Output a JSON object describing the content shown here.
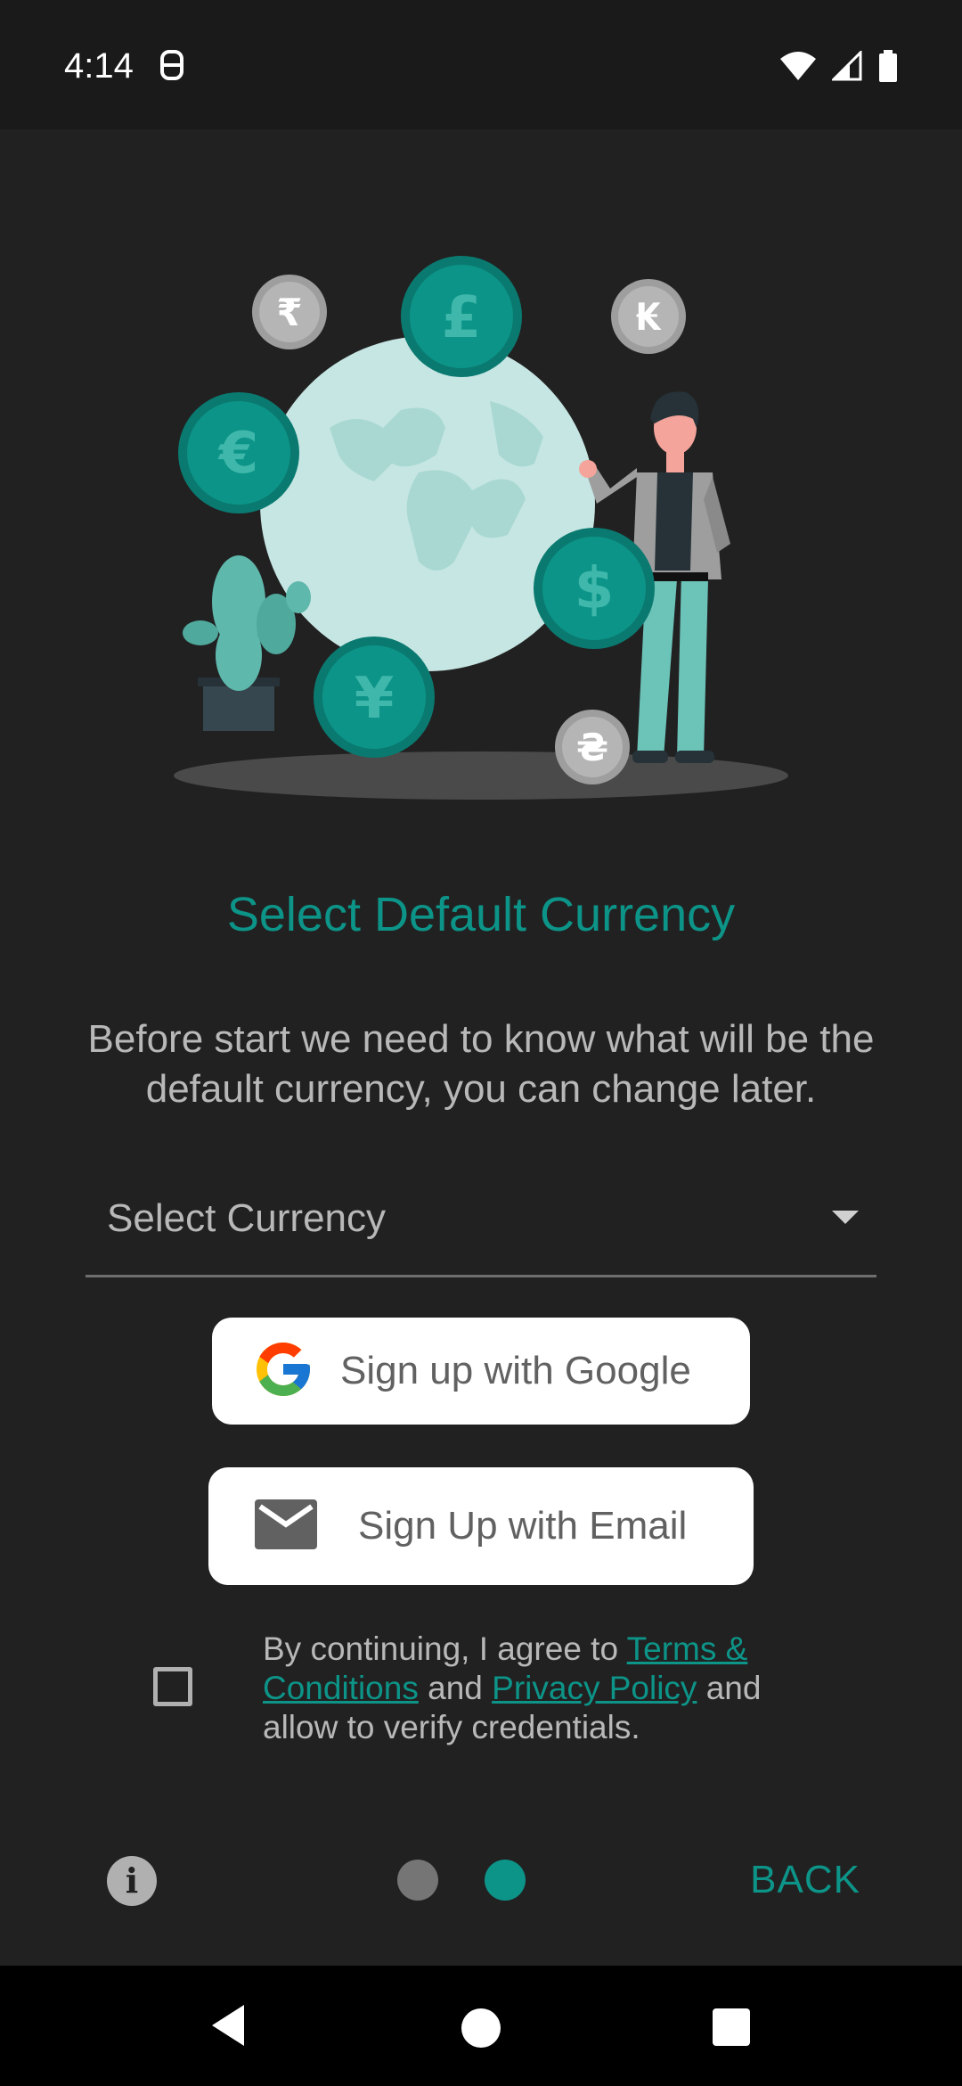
{
  "status_bar": {
    "time": "4:14"
  },
  "illustration": {
    "currency_symbols": [
      "₹",
      "£",
      "₭",
      "€",
      "$",
      "¥",
      "₴"
    ]
  },
  "onboarding": {
    "title": "Select Default Currency",
    "subtitle": "Before start we need to know what will be the default currency, you can change later."
  },
  "currency_select": {
    "placeholder": "Select Currency"
  },
  "buttons": {
    "google_label": "Sign up with Google",
    "email_label": "Sign Up with Email"
  },
  "agreement": {
    "prefix": "By continuing, I agree to ",
    "terms_link": "Terms & Conditions",
    "middle": " and ",
    "privacy_link": "Privacy Policy",
    "suffix": " and allow to verify credentials.",
    "checked": false
  },
  "bottom_nav": {
    "back_label": "BACK",
    "page_count": 2,
    "current_page": 2
  },
  "colors": {
    "accent": "#0d9488",
    "background": "#212121"
  }
}
